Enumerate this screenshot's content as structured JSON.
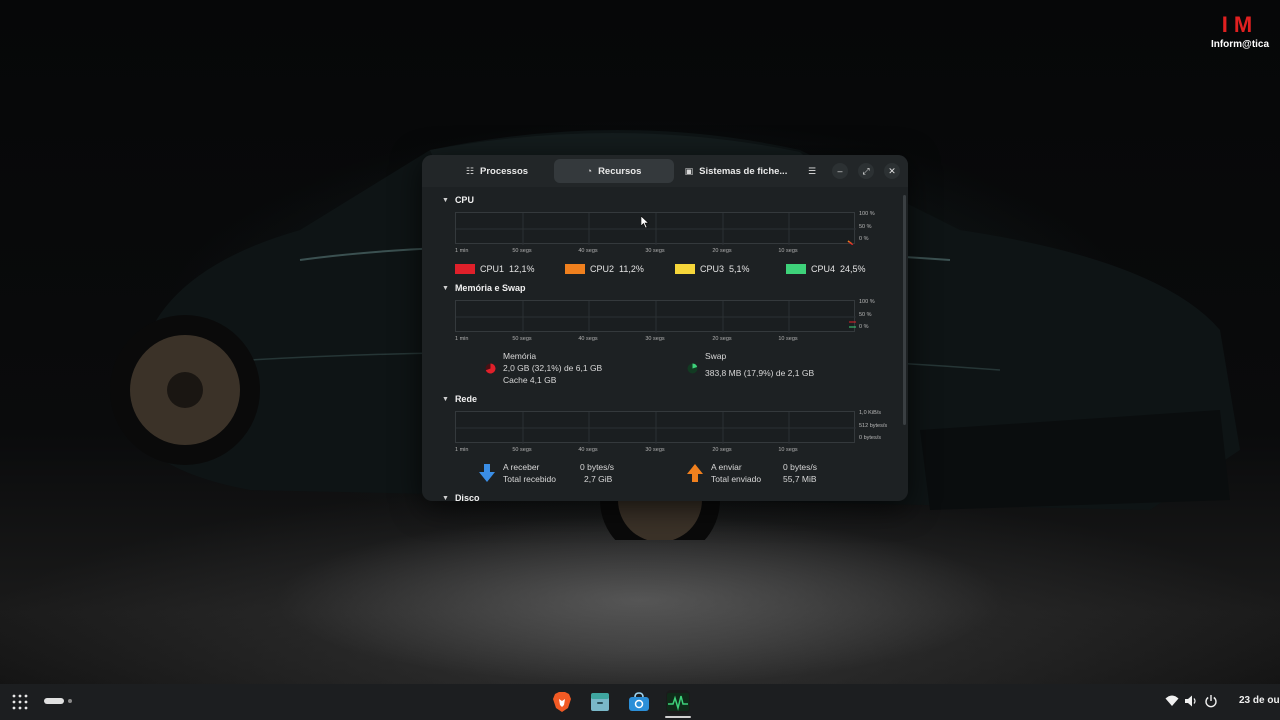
{
  "watermark": {
    "mark": "IM",
    "text": "Inform@tica"
  },
  "window": {
    "tabs": [
      {
        "label": "Processos",
        "icon": "list-icon"
      },
      {
        "label": "Recursos",
        "icon": "gauge-icon",
        "active": true
      },
      {
        "label": "Sistemas de fiche...",
        "icon": "disk-icon"
      }
    ]
  },
  "graph_axis": {
    "x": [
      "1 min",
      "50 segs",
      "40 segs",
      "30 segs",
      "20 segs",
      "10 segs"
    ],
    "percent": [
      "100 %",
      "50 %",
      "0 %"
    ],
    "network": [
      "1,0 KiB/s",
      "512 bytes/s",
      "0 bytes/s"
    ]
  },
  "cpu": {
    "title": "CPU",
    "cores": [
      {
        "name": "CPU1",
        "value": "12,1%",
        "color": "#e0202a"
      },
      {
        "name": "CPU2",
        "value": "11,2%",
        "color": "#f0801e"
      },
      {
        "name": "CPU3",
        "value": "5,1%",
        "color": "#f6d63a"
      },
      {
        "name": "CPU4",
        "value": "24,5%",
        "color": "#3ed27a"
      }
    ]
  },
  "memory": {
    "title": "Memória e Swap",
    "mem_label": "Memória",
    "mem_value": "2,0 GB (32,1%) de 6,1 GB",
    "cache": "Cache 4,1 GB",
    "mem_color": "#e0202a",
    "swap_label": "Swap",
    "swap_value": "383,8 MB (17,9%) de 2,1 GB",
    "swap_color": "#3ed27a"
  },
  "network": {
    "title": "Rede",
    "recv_label": "A receber",
    "recv_value": "0 bytes/s",
    "recv_total_label": "Total recebido",
    "recv_total": "2,7 GiB",
    "send_label": "A enviar",
    "send_value": "0 bytes/s",
    "send_total_label": "Total enviado",
    "send_total": "55,7 MiB"
  },
  "disk": {
    "title": "Disco"
  },
  "taskbar": {
    "clock": "23 de ou",
    "dock": [
      "brave-browser-icon",
      "files-icon",
      "software-store-icon",
      "system-monitor-icon"
    ]
  }
}
